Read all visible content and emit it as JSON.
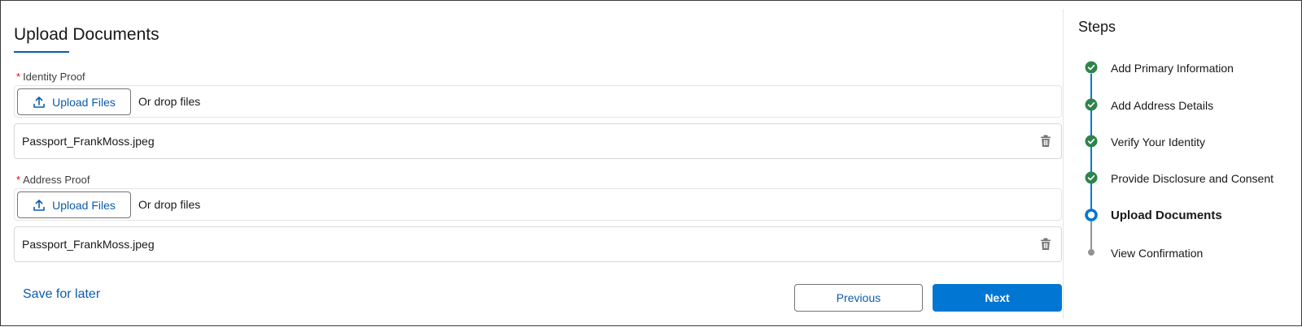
{
  "form": {
    "title": "Upload Documents",
    "fields": [
      {
        "required_marker": "*",
        "label": "Identity Proof",
        "upload_button_label": "Upload Files",
        "drop_hint": "Or drop files",
        "file_name": "Passport_FrankMoss.jpeg"
      },
      {
        "required_marker": "*",
        "label": "Address Proof",
        "upload_button_label": "Upload Files",
        "drop_hint": "Or drop files",
        "file_name": "Passport_FrankMoss.jpeg"
      }
    ],
    "save_later_label": "Save for later",
    "previous_label": "Previous",
    "next_label": "Next"
  },
  "steps": {
    "title": "Steps",
    "items": [
      {
        "label": "Add Primary Information",
        "status": "complete",
        "icon": "check-circle-icon"
      },
      {
        "label": "Add Address Details",
        "status": "complete",
        "icon": "check-circle-icon"
      },
      {
        "label": "Verify Your Identity",
        "status": "complete",
        "icon": "check-circle-icon"
      },
      {
        "label": "Provide Disclosure and Consent",
        "status": "complete",
        "icon": "check-circle-icon"
      },
      {
        "label": "Upload Documents",
        "status": "current",
        "icon": "current-step-ring-icon"
      },
      {
        "label": "View Confirmation",
        "status": "upcoming",
        "icon": "upcoming-dot-icon"
      }
    ]
  },
  "colors": {
    "brand_blue": "#0176d3",
    "link_blue": "#0b5cab",
    "complete_green": "#2e844a",
    "progress_line": "#0176d3",
    "upcoming_gray": "#939393",
    "required_red": "#ea001e"
  }
}
